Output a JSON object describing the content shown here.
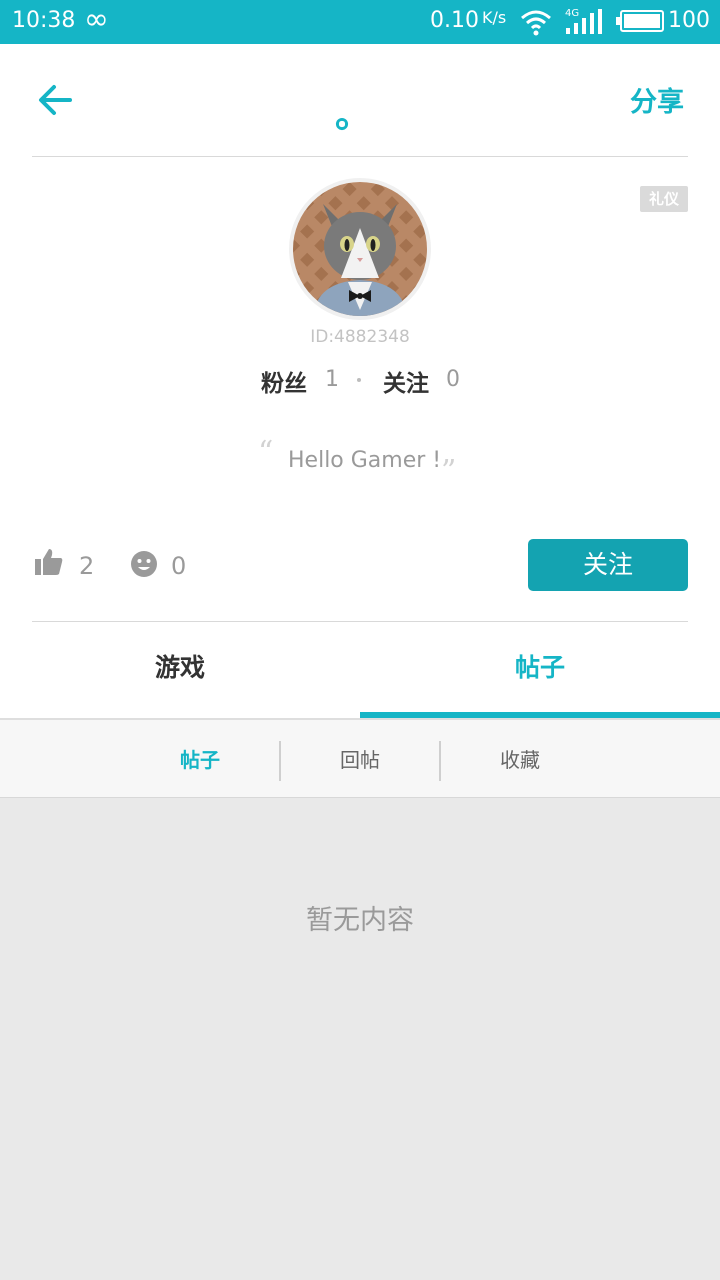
{
  "status_bar": {
    "time": "10:38",
    "infinity": "∞",
    "net_speed": "0.10",
    "net_speed_unit": "K/s",
    "network": "4G",
    "battery": "100"
  },
  "header": {
    "title": "。",
    "share_label": "分享"
  },
  "profile": {
    "tag": "礼仪",
    "id_text": "ID:4882348",
    "fans_label": "粉丝",
    "fans_count": "1",
    "following_label": "关注",
    "following_count": "0",
    "quote_open": "“",
    "signature": "Hello Gamer !",
    "quote_close": "”",
    "likes_count": "2",
    "smiles_count": "0",
    "follow_button": "关注"
  },
  "tabs": [
    {
      "label": "游戏"
    },
    {
      "label": "帖子"
    }
  ],
  "subtabs": [
    {
      "label": "帖子"
    },
    {
      "label": "回帖"
    },
    {
      "label": "收藏"
    }
  ],
  "empty_text": "暂无内容",
  "colors": {
    "accent": "#15b5c6",
    "follow_button": "#14a3b1",
    "background": "#e9e9e9"
  }
}
